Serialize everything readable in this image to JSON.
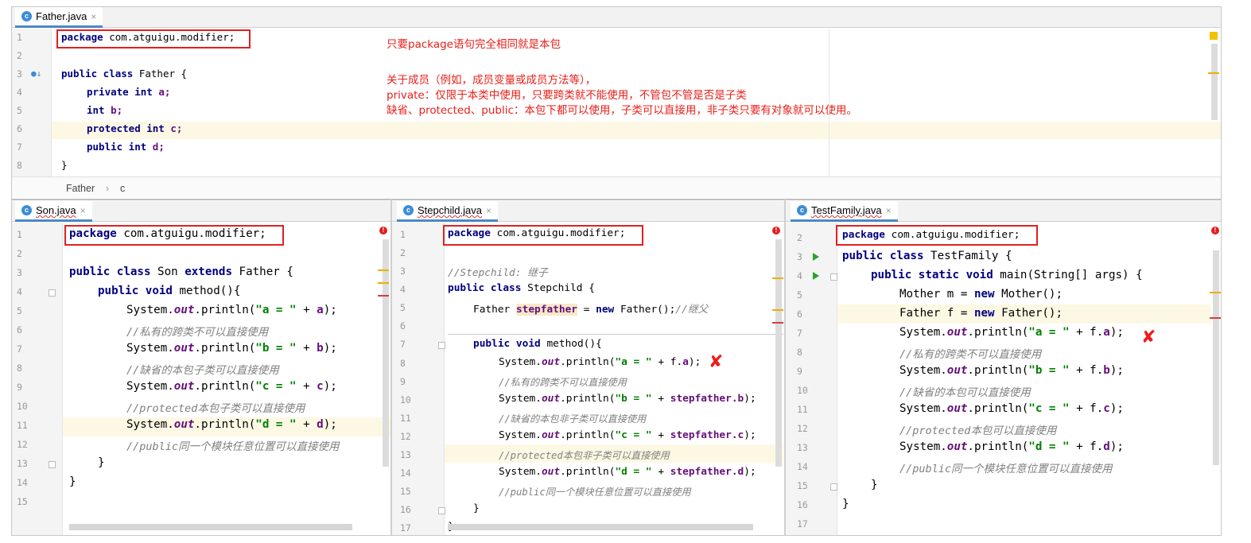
{
  "top_editor": {
    "tab": {
      "name": "Father.java",
      "close": "×"
    },
    "line_numbers": [
      "1",
      "2",
      "3",
      "4",
      "5",
      "6",
      "7",
      "8"
    ],
    "code": {
      "l1_kw": "package",
      "l1_rest": " com.atguigu.modifier;",
      "l3_kw": "public class",
      "l3_rest": " Father {",
      "l4_kw": "private int",
      "l4_rest": " a;",
      "l5_kw": "int",
      "l5_rest": " b;",
      "l6_kw": "protected int",
      "l6_rest": " c;",
      "l7_kw": "public int",
      "l7_rest": " d;",
      "l8": "}"
    },
    "breadcrumb": {
      "class": "Father",
      "sep": "›",
      "member": "c"
    },
    "notes": [
      "只要package语句完全相同就是本包",
      "关于成员（例如，成员变量或成员方法等），",
      "private：仅限于本类中使用，只要跨类就不能使用，不管包不管是否是子类",
      "缺省、protected、public：本包下都可以使用，子类可以直接用，非子类只要有对象就可以使用。"
    ]
  },
  "son_editor": {
    "tab": {
      "name": "Son.java",
      "close": "×"
    },
    "line_numbers": [
      "1",
      "2",
      "3",
      "4",
      "5",
      "6",
      "7",
      "8",
      "9",
      "10",
      "11",
      "12",
      "13",
      "14",
      "15"
    ],
    "code": {
      "pkg_kw": "package",
      "pkg_rest": " com.atguigu.modifier;",
      "cls_kw1": "public class",
      "cls_name": " Son ",
      "cls_kw2": "extends",
      "cls_rest": " Father {",
      "m_kw": "public void",
      "m_rest": " method(){",
      "sys": "System.",
      "out": "out",
      "println": ".println(",
      "str_a": "\"a = \"",
      "str_b": "\"b = \"",
      "str_c": "\"c = \"",
      "str_d": "\"d = \"",
      "plus": " + ",
      "fa": "a",
      "fb": "b",
      "fc": "c",
      "fd": "d",
      "end": ");",
      "c1": "//私有的跨类不可以直接使用",
      "c2": "//缺省的本包子类可以直接使用",
      "c3": "//protected本包子类可以直接使用",
      "c4": "//public同一个模块任意位置可以直接使用",
      "close1": "}",
      "close2": "}"
    }
  },
  "stepchild_editor": {
    "tab": {
      "name": "Stepchild.java",
      "close": "×"
    },
    "line_numbers": [
      "1",
      "2",
      "3",
      "4",
      "5",
      "6",
      "7",
      "8",
      "9",
      "10",
      "11",
      "12",
      "13",
      "14",
      "15",
      "16",
      "17"
    ],
    "code": {
      "pkg_kw": "package",
      "pkg_rest": " com.atguigu.modifier;",
      "c0": "//Stepchild: 继子",
      "cls_kw": "public class",
      "cls_rest": " Stepchild {",
      "f_type": "Father ",
      "f_var": "stepfather",
      "f_eq": " = ",
      "f_new": "new",
      "f_ctor": " Father();",
      "f_cmt": "//继父",
      "m_kw": "public void",
      "m_rest": " method(){",
      "sys": "System.",
      "out": "out",
      "println": ".println(",
      "str_a": "\"a = \"",
      "str_b": "\"b = \"",
      "str_c": "\"c = \"",
      "str_d": "\"d = \"",
      "plus": " + ",
      "fa_obj": "f.",
      "fa": "a",
      "sf": "stepfather",
      "fb": ".b",
      "fc": ".c",
      "fd": ".d",
      "end": ");",
      "c1": "//私有的跨类不可以直接使用",
      "c2": "//缺省的本包非子类可以直接使用",
      "c3": "//protected本包非子类可以直接使用",
      "c4": "//public同一个模块任意位置可以直接使用",
      "close1": "}",
      "close2": "}"
    }
  },
  "testfamily_editor": {
    "tab": {
      "name": "TestFamily.java",
      "close": "×"
    },
    "line_numbers": [
      "2",
      "3",
      "4",
      "5",
      "6",
      "7",
      "8",
      "9",
      "10",
      "11",
      "12",
      "13",
      "14",
      "15",
      "16",
      "17"
    ],
    "code": {
      "pkg_kw": "package",
      "pkg_rest": " com.atguigu.modifier;",
      "cls_kw": "public class",
      "cls_rest": " TestFamily {",
      "main_kw": "public static void",
      "main_rest": " main(String[] args) {",
      "mother_type": "Mother ",
      "mother_var": "m",
      "eq": " = ",
      "new": "new",
      "mother_ctor": " Mother();",
      "father_type": "Father ",
      "father_var": "f",
      "father_ctor": " Father();",
      "sys": "System.",
      "out": "out",
      "println": ".println(",
      "str_a": "\"a = \"",
      "str_b": "\"b = \"",
      "str_c": "\"c = \"",
      "str_d": "\"d = \"",
      "plus": " + ",
      "obj": "f.",
      "fa": "a",
      "fb": "b",
      "fc": "c",
      "fd": "d",
      "end": ");",
      "c1": "//私有的跨类不可以直接使用",
      "c2": "//缺省的本包可以直接使用",
      "c3": "//protected本包可以直接使用",
      "c4": "//public同一个模块任意位置可以直接使用",
      "close1": "}",
      "close2": "}"
    }
  },
  "colors": {
    "keyword": "#000080",
    "string": "#008000",
    "field": "#660e7a",
    "comment": "#808080",
    "annotation": "#e8201a",
    "highlight": "#fdf8e4"
  },
  "icons": [
    "class-icon",
    "close-icon",
    "error-icon",
    "run-icon",
    "cross-mark"
  ]
}
